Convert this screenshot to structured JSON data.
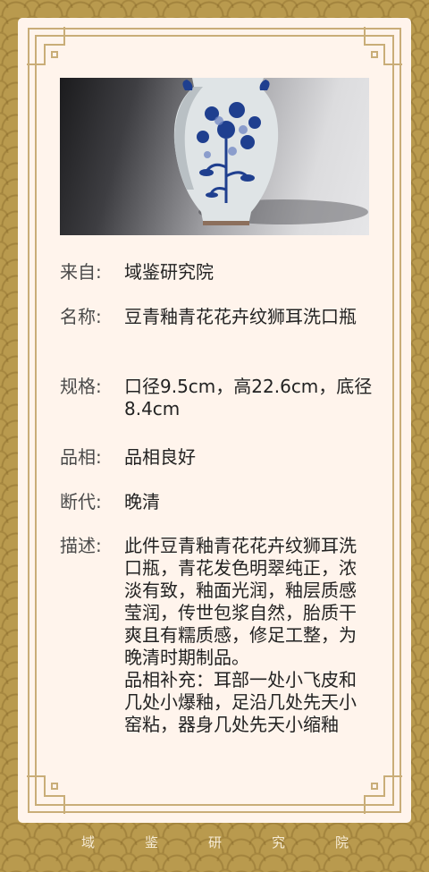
{
  "gallery": {
    "image": "blue-and-white-lion-ear-vase-photo",
    "slide_count": 2,
    "active_slide": 1
  },
  "details": [
    {
      "label": "来自:",
      "value": "域鉴研究院"
    },
    {
      "label": "名称:",
      "value": "豆青釉青花花卉纹狮耳洗口瓶"
    },
    {
      "label": "规格:",
      "value": "口径9.5cm，高22.6cm，底径8.4cm"
    },
    {
      "label": "品相:",
      "value": "品相良好"
    },
    {
      "label": "断代:",
      "value": "晚清"
    },
    {
      "label": "描述:",
      "value": "此件豆青釉青花花卉纹狮耳洗口瓶，青花发色明翠纯正，浓淡有致，釉面光润，釉层质感莹润，传世包浆自然，胎质干爽且有糯质感，修足工整，为晚清时期制品。\n品相补充：耳部一处小飞皮和几处小爆釉，足沿几处先天小窑粘，器身几处先天小缩釉"
    }
  ],
  "footer": {
    "chars": [
      "域",
      "鉴",
      "研",
      "究",
      "院"
    ]
  },
  "colors": {
    "background_gold": "#b99a4e",
    "card": "#fff4ec",
    "border_gold": "#c9ad78",
    "footer_text": "#f7ecd6"
  }
}
